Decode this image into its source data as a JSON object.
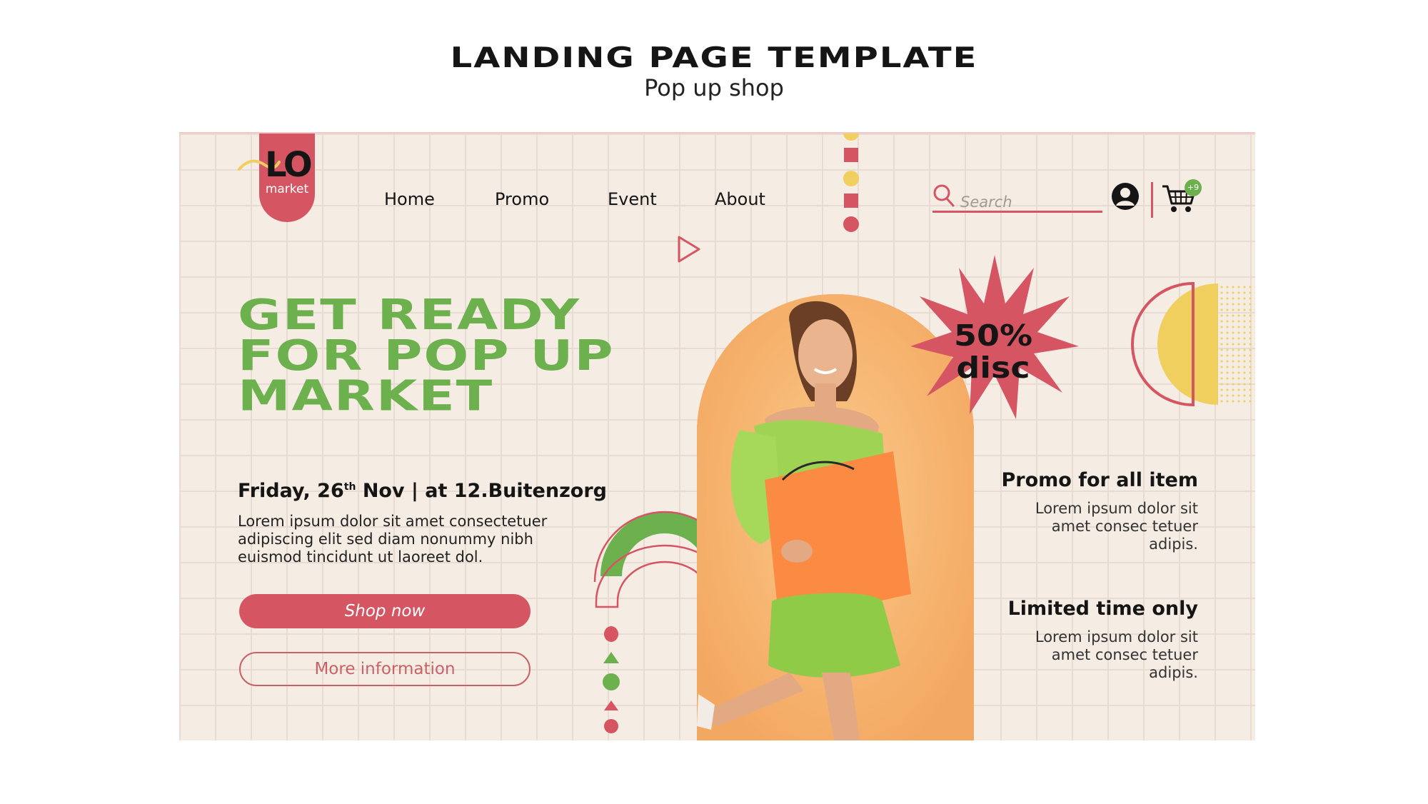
{
  "header": {
    "title": "LANDING PAGE TEMPLATE",
    "subtitle": "Pop up shop"
  },
  "logo": {
    "mark": "LO",
    "sub": "market"
  },
  "nav": {
    "items": [
      "Home",
      "Promo",
      "Event",
      "About"
    ]
  },
  "search": {
    "placeholder": "Search"
  },
  "cart": {
    "badge": "+9"
  },
  "hero": {
    "title_lines": [
      "GET READY",
      "FOR POP UP",
      "MARKET"
    ],
    "date_prefix": "Friday, 26",
    "date_sup": "th",
    "date_suffix": " Nov | at 12.Buitenzorg",
    "description": "Lorem ipsum dolor sit amet consectetuer adipiscing elit sed diam nonummy nibh euismod tincidunt ut laoreet dol.",
    "primary_button": "Shop now",
    "secondary_button": "More information"
  },
  "promo_badge": {
    "line1": "50%",
    "line2": "disc"
  },
  "side_info": [
    {
      "title": "Promo for all item",
      "desc": "Lorem ipsum dolor sit amet consec tetuer adipis."
    },
    {
      "title": "Limited time only",
      "desc": "Lorem ipsum dolor sit amet consec tetuer adipis."
    }
  ],
  "colors": {
    "accent_red": "#d65563",
    "accent_green": "#6db04e",
    "accent_yellow": "#f0cf5f",
    "accent_orange": "#f6b871",
    "background": "#f5ece4"
  },
  "icons": [
    "search-icon",
    "user-icon",
    "cart-icon",
    "play-icon"
  ]
}
